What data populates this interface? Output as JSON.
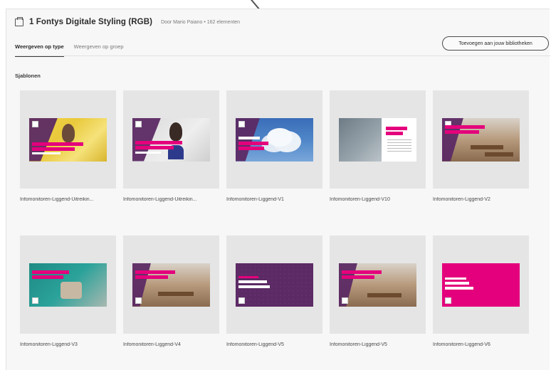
{
  "header": {
    "title": "1 Fontys Digitale Styling (RGB)",
    "subtitle": "Door Mario Paiano • 162 elementen"
  },
  "tabs": [
    {
      "label": "Weergeven op type",
      "active": true
    },
    {
      "label": "Weergeven op groep",
      "active": false
    }
  ],
  "add_button": {
    "label": "Toevoegen aan jouw bibliotheken"
  },
  "section": {
    "label": "Sjablonen"
  },
  "cards": [
    {
      "label": "Infomonitoren-Liggend-Uitreikin...",
      "thumb": "yellow-portrait"
    },
    {
      "label": "Infomonitoren-Liggend-Uitreikin...",
      "thumb": "gray-portrait"
    },
    {
      "label": "Infomonitoren-Liggend-V1",
      "thumb": "blue-cloud"
    },
    {
      "label": "Infomonitoren-Liggend-V10",
      "thumb": "office"
    },
    {
      "label": "Infomonitoren-Liggend-V2",
      "thumb": "cafe-purple"
    },
    {
      "label": "Infomonitoren-Liggend-V3",
      "thumb": "teal-office"
    },
    {
      "label": "Infomonitoren-Liggend-V4",
      "thumb": "cafe"
    },
    {
      "label": "Infomonitoren-Liggend-V5",
      "thumb": "purple-solid"
    },
    {
      "label": "Infomonitoren-Liggend-V5",
      "thumb": "cafe-2"
    },
    {
      "label": "Infomonitoren-Liggend-V6",
      "thumb": "magenta-solid"
    }
  ],
  "colors": {
    "fontys_purple": "#5c2a64",
    "fontys_magenta": "#e4007c",
    "panel_bg": "#f7f7f7",
    "tile_bg": "#e5e5e5"
  }
}
